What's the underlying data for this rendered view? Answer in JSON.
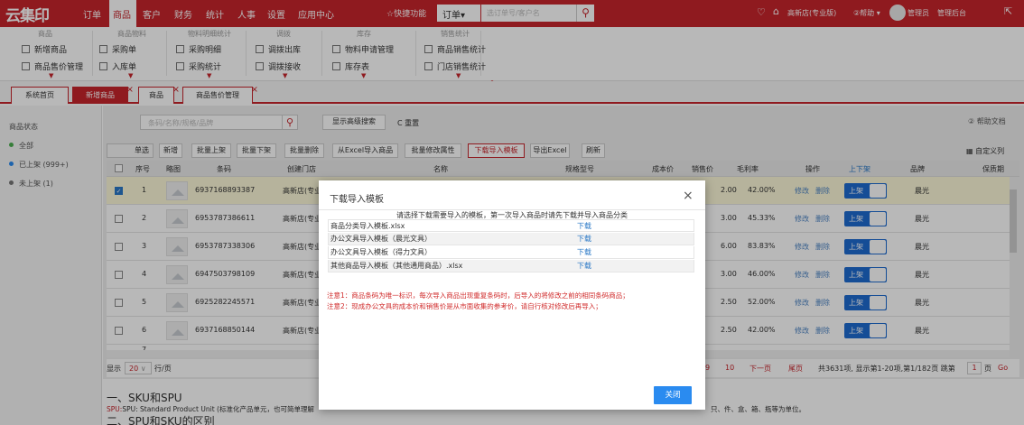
{
  "topbar": {
    "logo": "云集印",
    "menu": [
      "订单",
      "商品",
      "客户",
      "财务",
      "统计",
      "人事",
      "设置",
      "应用中心"
    ],
    "quick_label": "☆快捷功能",
    "order_select": "订单▾",
    "search_placeholder": "选订单号/客户名",
    "store": "高新店(专业版)",
    "help": "②帮助 ▾",
    "user": "管理员",
    "admin": "管理后台"
  },
  "submenu": {
    "groups": [
      {
        "header": "商品",
        "items": [
          "新增商品",
          "商品售价管理"
        ]
      },
      {
        "header": "商品物料",
        "items": [
          "采购单",
          "入库单"
        ]
      },
      {
        "header": "物料明细统计",
        "items": [
          "采购明细",
          "采购统计"
        ]
      },
      {
        "header": "调拨",
        "items": [
          "调拨出库",
          "调拨接收"
        ]
      },
      {
        "header": "库存",
        "items": [
          "物料申请管理",
          "库存表"
        ]
      },
      {
        "header": "销售统计",
        "items": [
          "商品销售统计",
          "门店销售统计"
        ]
      }
    ],
    "collapse": "︿"
  },
  "tabs": [
    "系统首页",
    "新增商品",
    "商品",
    "商品售价管理"
  ],
  "left": {
    "title": "商品状态",
    "items": [
      "全部",
      "已上架 (999+)",
      "未上架 (1)"
    ]
  },
  "toolbar": {
    "search_placeholder": "条码/名称/规格/品牌",
    "advanced": "显示高级搜索",
    "reset": "C 重置",
    "help": "② 帮助文档",
    "buttons": [
      "单选",
      "新增",
      "批量上架",
      "批量下架",
      "批量删除",
      "从Excel导入商品",
      "批量修改属性",
      "下载导入模板",
      "导出Excel",
      "刷新"
    ],
    "custom": "自定义列"
  },
  "table": {
    "headers": [
      "序号",
      "略图",
      "条码",
      "创建门店",
      "名称",
      "规格型号",
      "成本价",
      "销售价",
      "毛利率",
      "操作",
      "上下架",
      "品牌",
      "保质期"
    ],
    "rows": [
      {
        "no": "1",
        "code": "6937168893387",
        "store": "高新店(专业",
        "price": "2.00",
        "margin": "42.00%",
        "brand": "晨光",
        "checked": true
      },
      {
        "no": "2",
        "code": "6953787386611",
        "store": "高新店(专业",
        "price": "3.00",
        "margin": "45.33%",
        "brand": "晨光",
        "checked": false
      },
      {
        "no": "3",
        "code": "6953787338306",
        "store": "高新店(专业",
        "price": "6.00",
        "margin": "83.83%",
        "brand": "晨光",
        "checked": false
      },
      {
        "no": "4",
        "code": "6947503798109",
        "store": "高新店(专业",
        "price": "3.00",
        "margin": "46.00%",
        "brand": "晨光",
        "checked": false
      },
      {
        "no": "5",
        "code": "6925282245571",
        "store": "高新店(专业",
        "price": "2.50",
        "margin": "52.00%",
        "brand": "晨光",
        "checked": false
      },
      {
        "no": "6",
        "code": "6937168850144",
        "store": "高新店(专业",
        "price": "2.50",
        "margin": "42.00%",
        "brand": "晨光",
        "checked": false
      }
    ],
    "row7_no": "7",
    "edit": "修改",
    "del": "删除",
    "shelf": "上架"
  },
  "pager": {
    "show": "显示",
    "size": "20",
    "per_page": "行/页",
    "pages": [
      "9",
      "10"
    ],
    "next": "下一页",
    "last": "尾页",
    "summary": "共3631项, 显示第1-20项,第1/182页 跳第",
    "page_input": "1",
    "page_unit": "页",
    "go": "Go"
  },
  "doc": {
    "h1": "一、SKU和SPU",
    "line": "SPU: Standard Product Unit (标准化产品单元，也可简单理解",
    "line_tail": "只、件、盒、箱、瓶等为单位。",
    "h2": "二、SPU和SKU的区别"
  },
  "modal": {
    "title": "下载导入模板",
    "note": "请选择下载需要导入的模板，第一次导入商品时请先下载并导入商品分类",
    "templates": [
      "商品分类导入模板.xlsx",
      "办公文具导入模板（晨光文具）",
      "办公文具导入模板（得力文具）",
      "其他商品导入模板（其他通用商品）.xlsx"
    ],
    "download": "下载",
    "warn1": "注意1：商品条码为唯一标识，每次导入商品出现重复条码时，后导入的将修改之前的相同条码商品；",
    "warn2": "注意2：现成办公文具的成本价和销售价是从市面收集的参考价，请自行核对修改后再导入；",
    "close": "关闭"
  }
}
